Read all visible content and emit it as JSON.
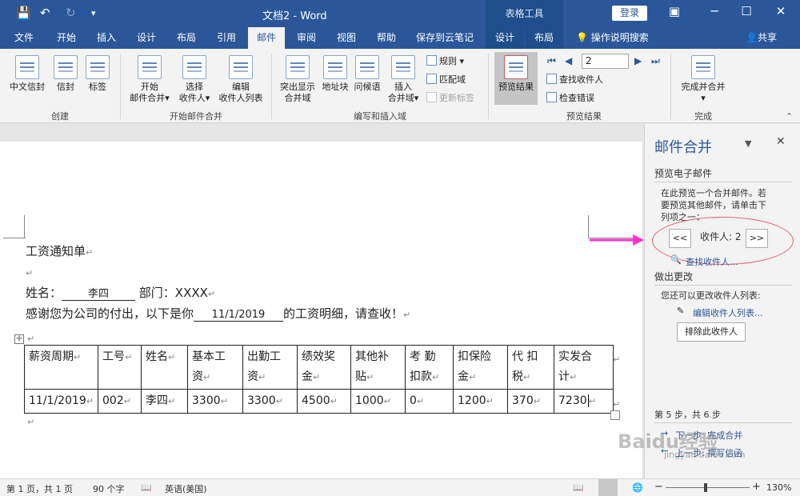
{
  "titlebar": {
    "title": "文档2 - Word",
    "context_tools": "表格工具",
    "login": "登录",
    "save_icon": "save-icon",
    "undo_icon": "undo-icon",
    "redo_icon": "redo-icon",
    "customize_icon": "customize-icon"
  },
  "tabs": [
    {
      "label": "文件"
    },
    {
      "label": "开始"
    },
    {
      "label": "插入"
    },
    {
      "label": "设计"
    },
    {
      "label": "布局"
    },
    {
      "label": "引用"
    },
    {
      "label": "邮件",
      "active": true
    },
    {
      "label": "审阅"
    },
    {
      "label": "视图"
    },
    {
      "label": "帮助"
    },
    {
      "label": "保存到云笔记"
    },
    {
      "label": "设计"
    },
    {
      "label": "布局"
    }
  ],
  "tellme": "操作说明搜索",
  "share": "共享",
  "ribbon": {
    "create": {
      "group": "创建",
      "chinese_envelope": "中文信封",
      "envelopes": "信封",
      "labels": "标签"
    },
    "start": {
      "group": "开始邮件合并",
      "start_merge_1": "开始",
      "start_merge_2": "邮件合并",
      "select_recipients_1": "选择",
      "select_recipients_2": "收件人",
      "edit_list": "编辑",
      "edit_list_2": "收件人列表"
    },
    "write": {
      "group": "编写和插入域",
      "highlight_1": "突出显示",
      "highlight_2": "合并域",
      "address_block": "地址块",
      "greeting": "问候语",
      "insert_field_1": "插入",
      "insert_field_2": "合并域",
      "rules": "规则",
      "match_fields": "匹配域",
      "update_labels": "更新标签"
    },
    "preview": {
      "group": "预览结果",
      "preview_results": "预览结果",
      "record": "2",
      "find_recipient": "查找收件人",
      "check_errors": "检查错误"
    },
    "finish": {
      "group": "完成",
      "finish_merge_1": "完成并合并"
    }
  },
  "document": {
    "heading": "工资通知单",
    "name_label": "姓名：",
    "name_value": "李四",
    "dept_label": "部门：XXXX",
    "thanks_before": "感谢您为公司的付出，以下是你",
    "date_value": "11/1/2019",
    "thanks_after": "的工资明细，请查收！",
    "table": {
      "headers": [
        [
          "薪资周期"
        ],
        [
          "工号"
        ],
        [
          "姓名"
        ],
        [
          "基本工",
          "资"
        ],
        [
          "出勤工",
          "资"
        ],
        [
          "绩效奖",
          "金"
        ],
        [
          "其他补",
          "贴"
        ],
        [
          "考 勤",
          "扣款"
        ],
        [
          "扣保险",
          "金"
        ],
        [
          "代 扣",
          "税"
        ],
        [
          "实发合",
          "计"
        ]
      ],
      "row": [
        "11/1/2019",
        "002",
        "李四",
        "3300",
        "3300",
        "4500",
        "1000",
        "0",
        "1200",
        "370",
        "7230"
      ]
    }
  },
  "pane": {
    "title": "邮件合并",
    "section1": "预览电子邮件",
    "desc1_l1": "在此预览一个合并邮件。若",
    "desc1_l2": "要预览其他邮件，请单击下",
    "desc1_l3": "列项之一：",
    "prev": "<<",
    "recipient": "收件人: 2",
    "next": ">>",
    "find": "查找收件人...",
    "section2": "做出更改",
    "desc2": "您还可以更改收件人列表:",
    "edit_list": "编辑收件人列表...",
    "exclude": "排除此收件人",
    "step": "第 5 步，共 6 步",
    "next_step": "下一步: 完成合并",
    "prev_step": "上一步: 撰写信函"
  },
  "status": {
    "page": "第 1 页，共 1 页",
    "words": "90 个字",
    "lang": "英语(美国)",
    "zoom": "130%"
  },
  "watermark": {
    "brand": "Baidu经验",
    "url": "jingyan.baidu.com"
  },
  "colors": {
    "accent": "#2b579a",
    "annotation": "#e45c6a",
    "arrow": "#ff33cc"
  }
}
